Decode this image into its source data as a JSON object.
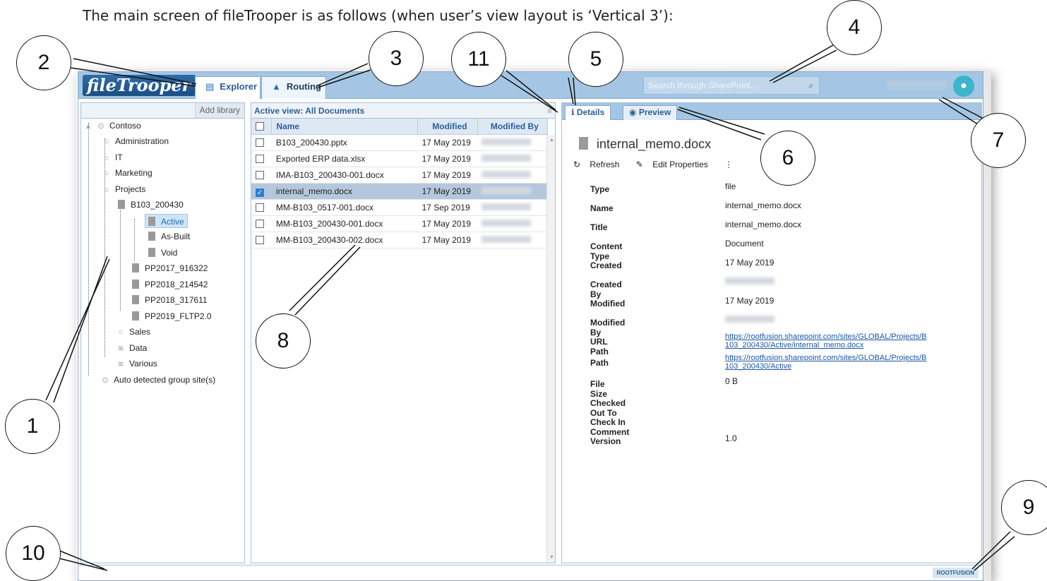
{
  "caption": "The main screen of fileTrooper is as follows (when user’s view layout is ‘Vertical 3’):",
  "header": {
    "logo": "fileTrooper",
    "tabs": [
      {
        "label": "Explorer",
        "icon": "book-icon"
      },
      {
        "label": "Routing",
        "icon": "road-icon"
      }
    ],
    "search_placeholder": "Search through SharePoint..."
  },
  "left": {
    "add_library": "Add library",
    "tree": [
      {
        "label": "Contoso",
        "icon": "site-radio-icon"
      },
      {
        "label": "Administration",
        "icon": "circle-icon"
      },
      {
        "label": "IT",
        "icon": "circle-icon"
      },
      {
        "label": "Marketing",
        "icon": "circle-icon"
      },
      {
        "label": "Projects",
        "icon": "circle-icon"
      },
      {
        "label": "B103_200430",
        "icon": "folder-icon"
      },
      {
        "label": "Active",
        "icon": "folder-icon",
        "selected": true
      },
      {
        "label": "As-Built",
        "icon": "folder-icon"
      },
      {
        "label": "Void",
        "icon": "folder-icon"
      },
      {
        "label": "PP2017_916322",
        "icon": "folder-icon"
      },
      {
        "label": "PP2018_214542",
        "icon": "folder-icon"
      },
      {
        "label": "PP2018_317611",
        "icon": "folder-icon"
      },
      {
        "label": "PP2019_FLTP2.0",
        "icon": "folder-icon"
      },
      {
        "label": "Sales",
        "icon": "circle-icon"
      },
      {
        "label": "Data",
        "icon": "stack-icon"
      },
      {
        "label": "Various",
        "icon": "stack-icon"
      },
      {
        "label": "Auto detected group site(s)",
        "icon": "site-radio-icon"
      }
    ]
  },
  "middle": {
    "view_label": "Active view: All Documents",
    "columns": [
      "Name",
      "Modified",
      "Modified By"
    ],
    "rows": [
      {
        "name": "B103_200430.pptx",
        "modified": "17 May 2019"
      },
      {
        "name": "Exported ERP data.xlsx",
        "modified": "17 May 2019"
      },
      {
        "name": "IMA-B103_200430-001.docx",
        "modified": "17 May 2019"
      },
      {
        "name": "internal_memo.docx",
        "modified": "17 May 2019",
        "selected": true
      },
      {
        "name": "MM-B103_0517-001.docx",
        "modified": "17 Sep 2019"
      },
      {
        "name": "MM-B103_200430-001.docx",
        "modified": "17 May 2019"
      },
      {
        "name": "MM-B103_200430-002.docx",
        "modified": "17 May 2019"
      }
    ]
  },
  "right": {
    "tabs": [
      "Details",
      "Preview"
    ],
    "file_name": "internal_memo.docx",
    "actions": [
      "Refresh",
      "Edit Properties"
    ],
    "props": [
      {
        "k": "Type",
        "v": "file"
      },
      {
        "k": "Name",
        "v": "internal_memo.docx"
      },
      {
        "k": "Title",
        "v": "internal_memo.docx"
      },
      {
        "k": "Content Type",
        "v": "Document"
      },
      {
        "k": "Created",
        "v": "17 May 2019"
      },
      {
        "k": "Created By",
        "v": ""
      },
      {
        "k": "Modified",
        "v": "17 May 2019"
      },
      {
        "k": "Modified By",
        "v": ""
      },
      {
        "k": "URL Path",
        "link1": "https://rootfusion.sharepoint.com/sites/GLOBAL/Projects/B",
        "link2": "103_200430/Active/internal_memo.docx"
      },
      {
        "k": "Path",
        "link1": "https://rootfusion.sharepoint.com/sites/GLOBAL/Projects/B",
        "link2": "103_200430/Active"
      },
      {
        "k": "File Size",
        "v": "0 B"
      },
      {
        "k": "Checked Out To",
        "v": ""
      },
      {
        "k": "Check In Comment",
        "v": ""
      },
      {
        "k": "Version",
        "v": "1.0"
      }
    ]
  },
  "status": {
    "brand": "ROOTFUSION"
  },
  "callouts": [
    "1",
    "2",
    "3",
    "4",
    "5",
    "6",
    "7",
    "8",
    "9",
    "10",
    "11"
  ]
}
